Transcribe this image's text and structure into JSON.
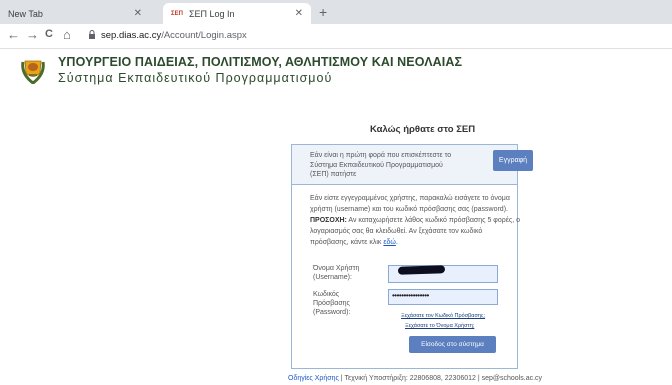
{
  "browser": {
    "tabs": [
      {
        "label": "New Tab",
        "close": "✕"
      },
      {
        "label": "ΣΕΠ Log In",
        "favicon": "ΣΕΠ",
        "close": "✕"
      }
    ],
    "new_tab": "+",
    "nav": {
      "back": "←",
      "forward": "→",
      "reload": "C",
      "home": "⌂"
    },
    "url_host": "sep.dias.ac.cy",
    "url_path": "/Account/Login.aspx"
  },
  "header": {
    "ministry": "ΥΠΟΥΡΓΕΙΟ ΠΑΙΔΕΙΑΣ, ΠΟΛΙΤΙΣΜΟΥ, ΑΘΛΗΤΙΣΜΟΥ ΚΑΙ ΝΕΟΛΑΙΑΣ",
    "system": "Σύστημα Εκπαιδευτικού Προγραμματισμού"
  },
  "welcome": "Καλώς ήρθατε στο ΣΕΠ",
  "first_time": {
    "text": "Εάν είναι η πρώτη φορά που επισκέπτεστε το Σύστημα Εκπαιδευτικού Προγραμματισμού (ΣΕΠ) πατήστε",
    "register_button": "Εγγραφή"
  },
  "login": {
    "intro": "Εάν είστε εγγεγραμμένος χρήστης, παρακαλώ εισάγετε το όνομα χρήστη (username) και του κωδικό πρόσβασης σας (password).",
    "warning_label": "ΠΡΟΣΟΧΗ:",
    "warning_text": " Αν καταχωρήσετε λάθος κωδικό πρόσβασης 5 φορές, ο λογαριασμός σας θα κλειδωθεί. Αν ξεχάσατε τον κωδικό πρόσβασης, κάντε κλικ ",
    "here_link": "εδώ",
    "here_suffix": ".",
    "username_label": "Όνομα Χρήστη (Username):",
    "password_label": "Κωδικός Πρόσβασης (Password):",
    "password_mask": "••••••••••••••••",
    "forgot_password": "Ξεχάσατε τον Κωδικό Πρόσβασης;",
    "forgot_username": "Ξεχάσατε το Όνομα Χρήστη;",
    "login_button": "Είσοδος στο σύστημα"
  },
  "footer": {
    "help": "Οδηγίες Χρήσης",
    "support": " | Τεχνική Υποστήριξη: 22806808, 22306012 | sep@schools.ac.cy"
  }
}
